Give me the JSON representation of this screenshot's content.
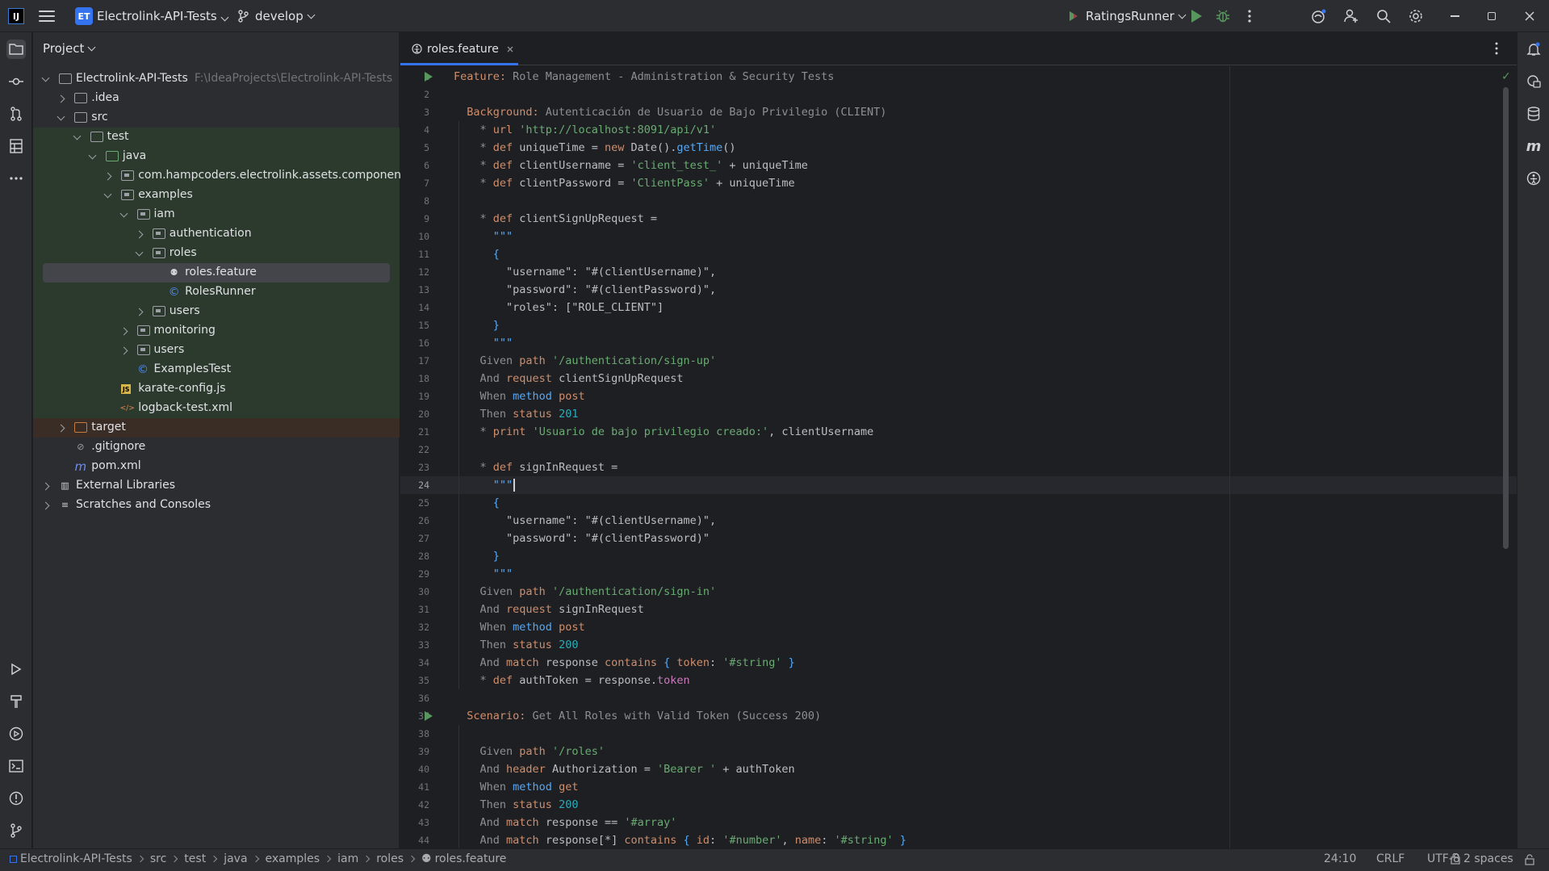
{
  "titlebar": {
    "app_logo": "IJ",
    "project_badge": "ET",
    "project_name": "Electrolink-API-Tests",
    "branch": "develop",
    "run_config": "RatingsRunner"
  },
  "project_panel": {
    "title": "Project",
    "tree": [
      {
        "label": "Electrolink-API-Tests",
        "hint": "F:\\IdeaProjects\\Electrolink-API-Tests",
        "depth": 0,
        "arrow": "open",
        "icon": "module"
      },
      {
        "label": ".idea",
        "depth": 1,
        "arrow": "closed",
        "icon": "folder"
      },
      {
        "label": "src",
        "depth": 1,
        "arrow": "open",
        "icon": "folder"
      },
      {
        "label": "test",
        "depth": 2,
        "arrow": "open",
        "icon": "folder"
      },
      {
        "label": "java",
        "depth": 3,
        "arrow": "open",
        "icon": "folder-test"
      },
      {
        "label": "com.hampcoders.electrolink.assets.component",
        "depth": 4,
        "arrow": "closed",
        "icon": "package"
      },
      {
        "label": "examples",
        "depth": 4,
        "arrow": "open",
        "icon": "package"
      },
      {
        "label": "iam",
        "depth": 5,
        "arrow": "open",
        "icon": "package"
      },
      {
        "label": "authentication",
        "depth": 6,
        "arrow": "closed",
        "icon": "package"
      },
      {
        "label": "roles",
        "depth": 6,
        "arrow": "open",
        "icon": "package"
      },
      {
        "label": "roles.feature",
        "depth": 7,
        "arrow": "none",
        "icon": "karate"
      },
      {
        "label": "RolesRunner",
        "depth": 7,
        "arrow": "none",
        "icon": "class"
      },
      {
        "label": "users",
        "depth": 6,
        "arrow": "closed",
        "icon": "package"
      },
      {
        "label": "monitoring",
        "depth": 5,
        "arrow": "closed",
        "icon": "package"
      },
      {
        "label": "users",
        "depth": 5,
        "arrow": "closed",
        "icon": "package"
      },
      {
        "label": "ExamplesTest",
        "depth": 5,
        "arrow": "none",
        "icon": "class"
      },
      {
        "label": "karate-config.js",
        "depth": 4,
        "arrow": "none",
        "icon": "js"
      },
      {
        "label": "logback-test.xml",
        "depth": 4,
        "arrow": "none",
        "icon": "xml"
      },
      {
        "label": "target",
        "depth": 1,
        "arrow": "closed",
        "icon": "folder-excluded"
      },
      {
        "label": ".gitignore",
        "depth": 1,
        "arrow": "none",
        "icon": "ignore"
      },
      {
        "label": "pom.xml",
        "depth": 1,
        "arrow": "none",
        "icon": "maven"
      },
      {
        "label": "External Libraries",
        "depth": 0,
        "arrow": "closed",
        "icon": "library"
      },
      {
        "label": "Scratches and Consoles",
        "depth": 0,
        "arrow": "closed",
        "icon": "scratch"
      }
    ]
  },
  "editor": {
    "tab_label": "roles.feature",
    "current_line": 24,
    "lines": [
      [
        [
          "kw",
          "Feature:"
        ],
        [
          "gray",
          " Role Management - Administration & Security Tests"
        ]
      ],
      [],
      [
        [
          "t",
          "  "
        ],
        [
          "kw",
          "Background:"
        ],
        [
          "gray",
          " Autenticación de Usuario de Bajo Privilegio (CLIENT)"
        ]
      ],
      [
        [
          "t",
          "    "
        ],
        [
          "gray",
          "* "
        ],
        [
          "kw",
          "url "
        ],
        [
          "str",
          "'http://localhost:8091/api/v1'"
        ]
      ],
      [
        [
          "t",
          "    "
        ],
        [
          "gray",
          "* "
        ],
        [
          "kw",
          "def "
        ],
        [
          "t",
          "uniqueTime = "
        ],
        [
          "kw",
          "new "
        ],
        [
          "t",
          "Date()."
        ],
        [
          "fn",
          "getTime"
        ],
        [
          "t",
          "()"
        ]
      ],
      [
        [
          "t",
          "    "
        ],
        [
          "gray",
          "* "
        ],
        [
          "kw",
          "def "
        ],
        [
          "t",
          "clientUsername = "
        ],
        [
          "str",
          "'client_test_'"
        ],
        [
          "t",
          " + uniqueTime"
        ]
      ],
      [
        [
          "t",
          "    "
        ],
        [
          "gray",
          "* "
        ],
        [
          "kw",
          "def "
        ],
        [
          "t",
          "clientPassword = "
        ],
        [
          "str",
          "'ClientPass'"
        ],
        [
          "t",
          " + uniqueTime"
        ]
      ],
      [],
      [
        [
          "t",
          "    "
        ],
        [
          "gray",
          "* "
        ],
        [
          "kw",
          "def "
        ],
        [
          "t",
          "clientSignUpRequest ="
        ]
      ],
      [
        [
          "t",
          "      "
        ],
        [
          "fn",
          "\"\"\""
        ]
      ],
      [
        [
          "t",
          "      "
        ],
        [
          "fn",
          "{"
        ]
      ],
      [
        [
          "t",
          "        "
        ],
        [
          "t",
          "\"username\": "
        ],
        [
          "t",
          "\"#(clientUsername)\","
        ]
      ],
      [
        [
          "t",
          "        "
        ],
        [
          "t",
          "\"password\": "
        ],
        [
          "t",
          "\"#(clientPassword)\","
        ]
      ],
      [
        [
          "t",
          "        "
        ],
        [
          "t",
          "\"roles\": [\"ROLE_CLIENT\"]"
        ]
      ],
      [
        [
          "t",
          "      "
        ],
        [
          "fn",
          "}"
        ]
      ],
      [
        [
          "t",
          "      "
        ],
        [
          "fn",
          "\"\"\""
        ]
      ],
      [
        [
          "t",
          "    "
        ],
        [
          "gray",
          "Given "
        ],
        [
          "kw",
          "path "
        ],
        [
          "str",
          "'/authentication/sign-up'"
        ]
      ],
      [
        [
          "t",
          "    "
        ],
        [
          "gray",
          "And "
        ],
        [
          "kw",
          "request "
        ],
        [
          "t",
          "clientSignUpRequest"
        ]
      ],
      [
        [
          "t",
          "    "
        ],
        [
          "gray",
          "When "
        ],
        [
          "fn",
          "method "
        ],
        [
          "kw",
          "post"
        ]
      ],
      [
        [
          "t",
          "    "
        ],
        [
          "gray",
          "Then "
        ],
        [
          "kw",
          "status "
        ],
        [
          "num",
          "201"
        ]
      ],
      [
        [
          "t",
          "    "
        ],
        [
          "gray",
          "* "
        ],
        [
          "kw",
          "print "
        ],
        [
          "str",
          "'Usuario de bajo privilegio creado:'"
        ],
        [
          "t",
          ", clientUsername"
        ]
      ],
      [],
      [
        [
          "t",
          "    "
        ],
        [
          "gray",
          "* "
        ],
        [
          "kw",
          "def "
        ],
        [
          "t",
          "signInRequest ="
        ]
      ],
      [
        [
          "t",
          "      "
        ],
        [
          "fn",
          "\"\"\""
        ]
      ],
      [
        [
          "t",
          "      "
        ],
        [
          "fn",
          "{"
        ]
      ],
      [
        [
          "t",
          "        "
        ],
        [
          "t",
          "\"username\": "
        ],
        [
          "t",
          "\"#(clientUsername)\","
        ]
      ],
      [
        [
          "t",
          "        "
        ],
        [
          "t",
          "\"password\": "
        ],
        [
          "t",
          "\"#(clientPassword)\""
        ]
      ],
      [
        [
          "t",
          "      "
        ],
        [
          "fn",
          "}"
        ]
      ],
      [
        [
          "t",
          "      "
        ],
        [
          "fn",
          "\"\"\""
        ]
      ],
      [
        [
          "t",
          "    "
        ],
        [
          "gray",
          "Given "
        ],
        [
          "kw",
          "path "
        ],
        [
          "str",
          "'/authentication/sign-in'"
        ]
      ],
      [
        [
          "t",
          "    "
        ],
        [
          "gray",
          "And "
        ],
        [
          "kw",
          "request "
        ],
        [
          "t",
          "signInRequest"
        ]
      ],
      [
        [
          "t",
          "    "
        ],
        [
          "gray",
          "When "
        ],
        [
          "fn",
          "method "
        ],
        [
          "kw",
          "post"
        ]
      ],
      [
        [
          "t",
          "    "
        ],
        [
          "gray",
          "Then "
        ],
        [
          "kw",
          "status "
        ],
        [
          "num",
          "200"
        ]
      ],
      [
        [
          "t",
          "    "
        ],
        [
          "gray",
          "And "
        ],
        [
          "kw",
          "match "
        ],
        [
          "t",
          "response "
        ],
        [
          "kw",
          "contains "
        ],
        [
          "fn",
          "{ "
        ],
        [
          "kw",
          "token"
        ],
        [
          "t",
          ": "
        ],
        [
          "str",
          "'#string'"
        ],
        [
          "fn",
          " }"
        ]
      ],
      [
        [
          "t",
          "    "
        ],
        [
          "gray",
          "* "
        ],
        [
          "kw",
          "def "
        ],
        [
          "t",
          "authToken = response."
        ],
        [
          "prop",
          "token"
        ]
      ],
      [],
      [
        [
          "t",
          "  "
        ],
        [
          "kw",
          "Scenario:"
        ],
        [
          "gray",
          " Get All Roles with Valid Token (Success 200)"
        ]
      ],
      [],
      [
        [
          "t",
          "    "
        ],
        [
          "gray",
          "Given "
        ],
        [
          "kw",
          "path "
        ],
        [
          "str",
          "'/roles'"
        ]
      ],
      [
        [
          "t",
          "    "
        ],
        [
          "gray",
          "And "
        ],
        [
          "kw",
          "header "
        ],
        [
          "t",
          "Authorization = "
        ],
        [
          "str",
          "'Bearer '"
        ],
        [
          "t",
          " + authToken"
        ]
      ],
      [
        [
          "t",
          "    "
        ],
        [
          "gray",
          "When "
        ],
        [
          "fn",
          "method "
        ],
        [
          "kw",
          "get"
        ]
      ],
      [
        [
          "t",
          "    "
        ],
        [
          "gray",
          "Then "
        ],
        [
          "kw",
          "status "
        ],
        [
          "num",
          "200"
        ]
      ],
      [
        [
          "t",
          "    "
        ],
        [
          "gray",
          "And "
        ],
        [
          "kw",
          "match "
        ],
        [
          "t",
          "response == "
        ],
        [
          "str",
          "'#array'"
        ]
      ],
      [
        [
          "t",
          "    "
        ],
        [
          "gray",
          "And "
        ],
        [
          "kw",
          "match "
        ],
        [
          "t",
          "response[*] "
        ],
        [
          "kw",
          "contains "
        ],
        [
          "fn",
          "{ "
        ],
        [
          "kw",
          "id"
        ],
        [
          "t",
          ": "
        ],
        [
          "str",
          "'#number'"
        ],
        [
          "t",
          ", "
        ],
        [
          "kw",
          "name"
        ],
        [
          "t",
          ": "
        ],
        [
          "str",
          "'#string'"
        ],
        [
          "fn",
          " }"
        ]
      ]
    ],
    "run_marker_lines": [
      1,
      37
    ]
  },
  "statusbar": {
    "breadcrumbs": [
      "Electrolink-API-Tests",
      "src",
      "test",
      "java",
      "examples",
      "iam",
      "roles",
      "roles.feature"
    ],
    "position": "24:10",
    "line_separator": "CRLF",
    "encoding": "UTF-8",
    "indent": "2 spaces"
  }
}
